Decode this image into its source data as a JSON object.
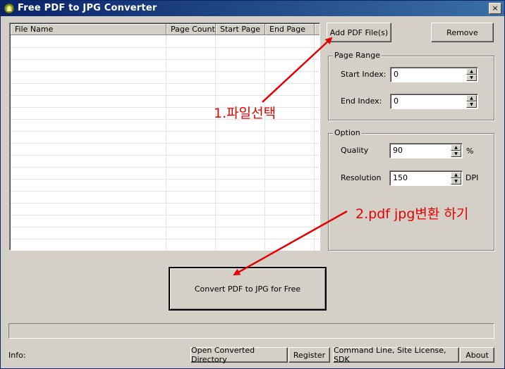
{
  "window": {
    "title": "Free PDF to JPG Converter",
    "close_glyph": "×"
  },
  "file_list": {
    "columns": [
      "File Name",
      "Page Count",
      "Start Page",
      "End Page"
    ],
    "rows": []
  },
  "buttons": {
    "add_pdf": "Add PDF File(s)",
    "remove": "Remove",
    "convert": "Convert PDF to JPG for Free",
    "open_dir": "Open Converted Directory",
    "register": "Register",
    "command_line": "Command Line, Site License, SDK",
    "about": "About"
  },
  "page_range": {
    "legend": "Page Range",
    "start_label": "Start Index:",
    "start_value": "0",
    "end_label": "End Index:",
    "end_value": "0"
  },
  "option": {
    "legend": "Option",
    "quality_label": "Quality",
    "quality_value": "90",
    "quality_unit": "%",
    "resolution_label": "Resolution",
    "resolution_value": "150",
    "resolution_unit": "DPI"
  },
  "status": {
    "info_label": "Info:",
    "progress": 0
  },
  "annotations": {
    "step1": "1.파일선택",
    "step2": "2.pdf jpg변환 하기",
    "color": "#e60000"
  },
  "icons": {
    "app": "app-icon",
    "close": "close-icon",
    "spin_up": "spin-up-icon",
    "spin_down": "spin-down-icon"
  }
}
